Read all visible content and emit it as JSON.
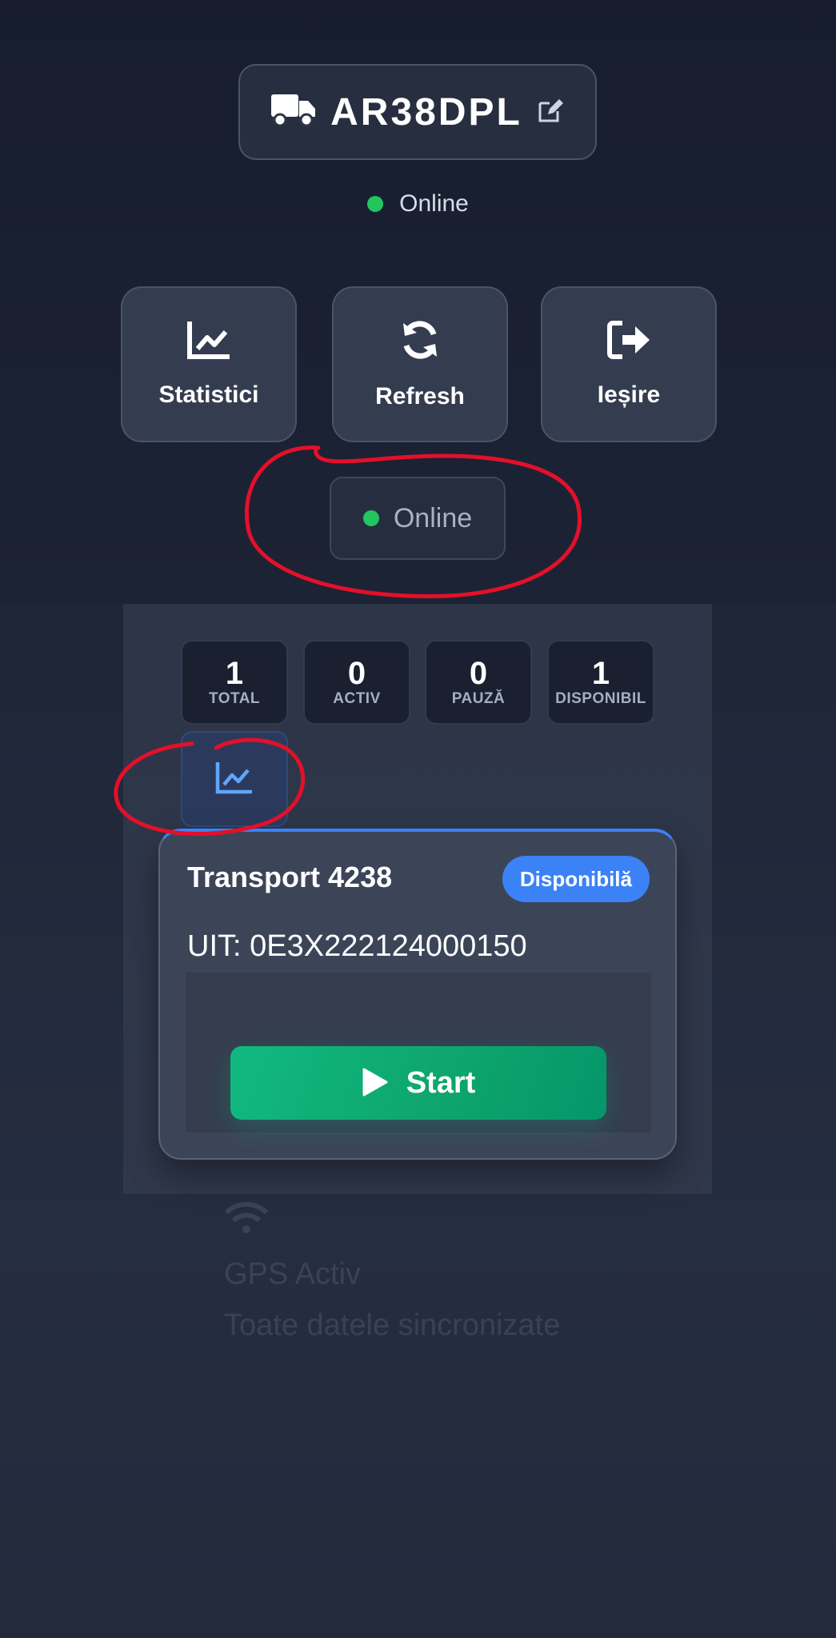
{
  "header": {
    "vehicle_plate": "AR38DPL",
    "status_text": "Online",
    "status_color": "#22c55e"
  },
  "actions": [
    {
      "label": "Statistici",
      "icon": "chart-line-icon"
    },
    {
      "label": "Refresh",
      "icon": "sync-icon"
    },
    {
      "label": "Ieșire",
      "icon": "sign-out-icon"
    }
  ],
  "connection_chip": {
    "text": "Online"
  },
  "stats": [
    {
      "value": "1",
      "label": "TOTAL"
    },
    {
      "value": "0",
      "label": "ACTIV"
    },
    {
      "value": "0",
      "label": "PAUZĂ"
    },
    {
      "value": "1",
      "label": "DISPONIBIL"
    }
  ],
  "transport": {
    "title": "Transport 4238",
    "badge": "Disponibilă",
    "uit": "UIT: 0E3X222124000150",
    "start_label": "Start"
  },
  "footer": {
    "gps_text": "GPS Activ",
    "sync_text": "Toate datele sincronizate"
  },
  "colors": {
    "accent_blue": "#3b82f6",
    "start_green": "#10b981",
    "annotation_red": "#e3102a"
  }
}
